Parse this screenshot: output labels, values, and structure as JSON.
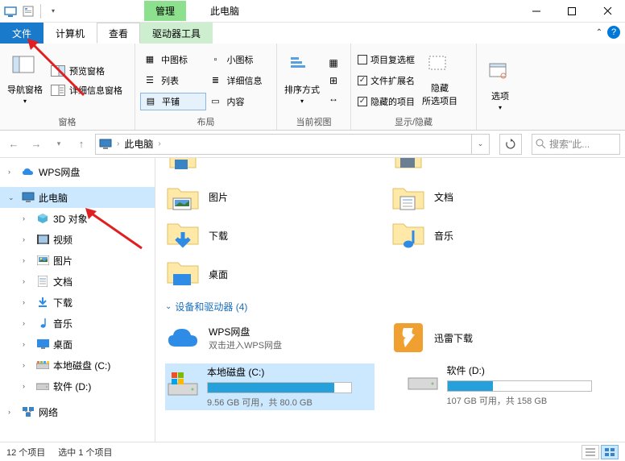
{
  "title": {
    "context_tab": "管理",
    "main": "此电脑"
  },
  "tabs": {
    "file": "文件",
    "computer": "计算机",
    "view": "查看",
    "drive_tools": "驱动器工具"
  },
  "ribbon": {
    "panes_group": "窗格",
    "nav_pane": "导航窗格",
    "preview": "预览窗格",
    "details_pane": "详细信息窗格",
    "layout_group": "布局",
    "med_icons": "中图标",
    "small_icons": "小图标",
    "list": "列表",
    "details": "详细信息",
    "tiles": "平铺",
    "content": "内容",
    "current_view_group": "当前视图",
    "sort_by": "排序方式",
    "showhide_group": "显示/隐藏",
    "item_check": "项目复选框",
    "file_ext": "文件扩展名",
    "hidden_items": "隐藏的项目",
    "hide_selected": "隐藏\n所选项目",
    "options": "选项"
  },
  "address": {
    "location": "此电脑"
  },
  "search": {
    "placeholder": "搜索\"此..."
  },
  "sidebar": {
    "wps": "WPS网盘",
    "this_pc": "此电脑",
    "objects3d": "3D 对象",
    "videos": "视频",
    "pictures": "图片",
    "documents": "文档",
    "downloads": "下载",
    "music": "音乐",
    "desktop": "桌面",
    "disk_c": "本地磁盘 (C:)",
    "disk_d": "软件 (D:)",
    "network": "网络"
  },
  "folders": {
    "pictures": "图片",
    "documents": "文档",
    "downloads": "下载",
    "music": "音乐",
    "desktop": "桌面"
  },
  "section_devices": "设备和驱动器 (4)",
  "items": {
    "wps": {
      "name": "WPS网盘",
      "sub": "双击进入WPS网盘"
    },
    "xunlei": {
      "name": "迅雷下载"
    }
  },
  "drives": {
    "c": {
      "name": "本地磁盘 (C:)",
      "sub": "9.56 GB 可用，共 80.0 GB",
      "pct": 88
    },
    "d": {
      "name": "软件 (D:)",
      "sub": "107 GB 可用，共 158 GB",
      "pct": 32
    }
  },
  "status": {
    "count": "12 个项目",
    "selected": "选中 1 个项目"
  }
}
